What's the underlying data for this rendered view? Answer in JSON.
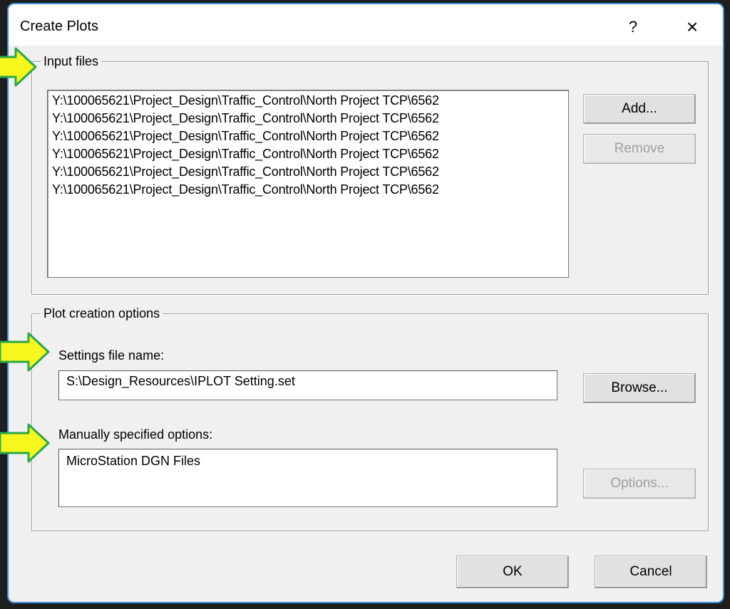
{
  "dialog": {
    "title": "Create Plots",
    "help_label": "?",
    "close_label": "×"
  },
  "input_files": {
    "legend": "Input files",
    "items": [
      "Y:\\100065621\\Project_Design\\Traffic_Control\\North Project TCP\\6562",
      "Y:\\100065621\\Project_Design\\Traffic_Control\\North Project TCP\\6562",
      "Y:\\100065621\\Project_Design\\Traffic_Control\\North Project TCP\\6562",
      "Y:\\100065621\\Project_Design\\Traffic_Control\\North Project TCP\\6562",
      "Y:\\100065621\\Project_Design\\Traffic_Control\\North Project TCP\\6562",
      "Y:\\100065621\\Project_Design\\Traffic_Control\\North Project TCP\\6562"
    ],
    "add_label": "Add...",
    "remove_label": "Remove"
  },
  "plot_options": {
    "legend": "Plot creation options",
    "settings_label": "Settings file name:",
    "settings_value": "S:\\Design_Resources\\IPLOT Setting.set",
    "browse_label": "Browse...",
    "manual_label": "Manually specified options:",
    "manual_value": "MicroStation DGN Files",
    "options_label": "Options..."
  },
  "footer": {
    "ok_label": "OK",
    "cancel_label": "Cancel"
  },
  "colors": {
    "arrow_fill": "#f7f71e",
    "arrow_stroke": "#2aa84a",
    "dialog_border": "#3a8ed4"
  }
}
